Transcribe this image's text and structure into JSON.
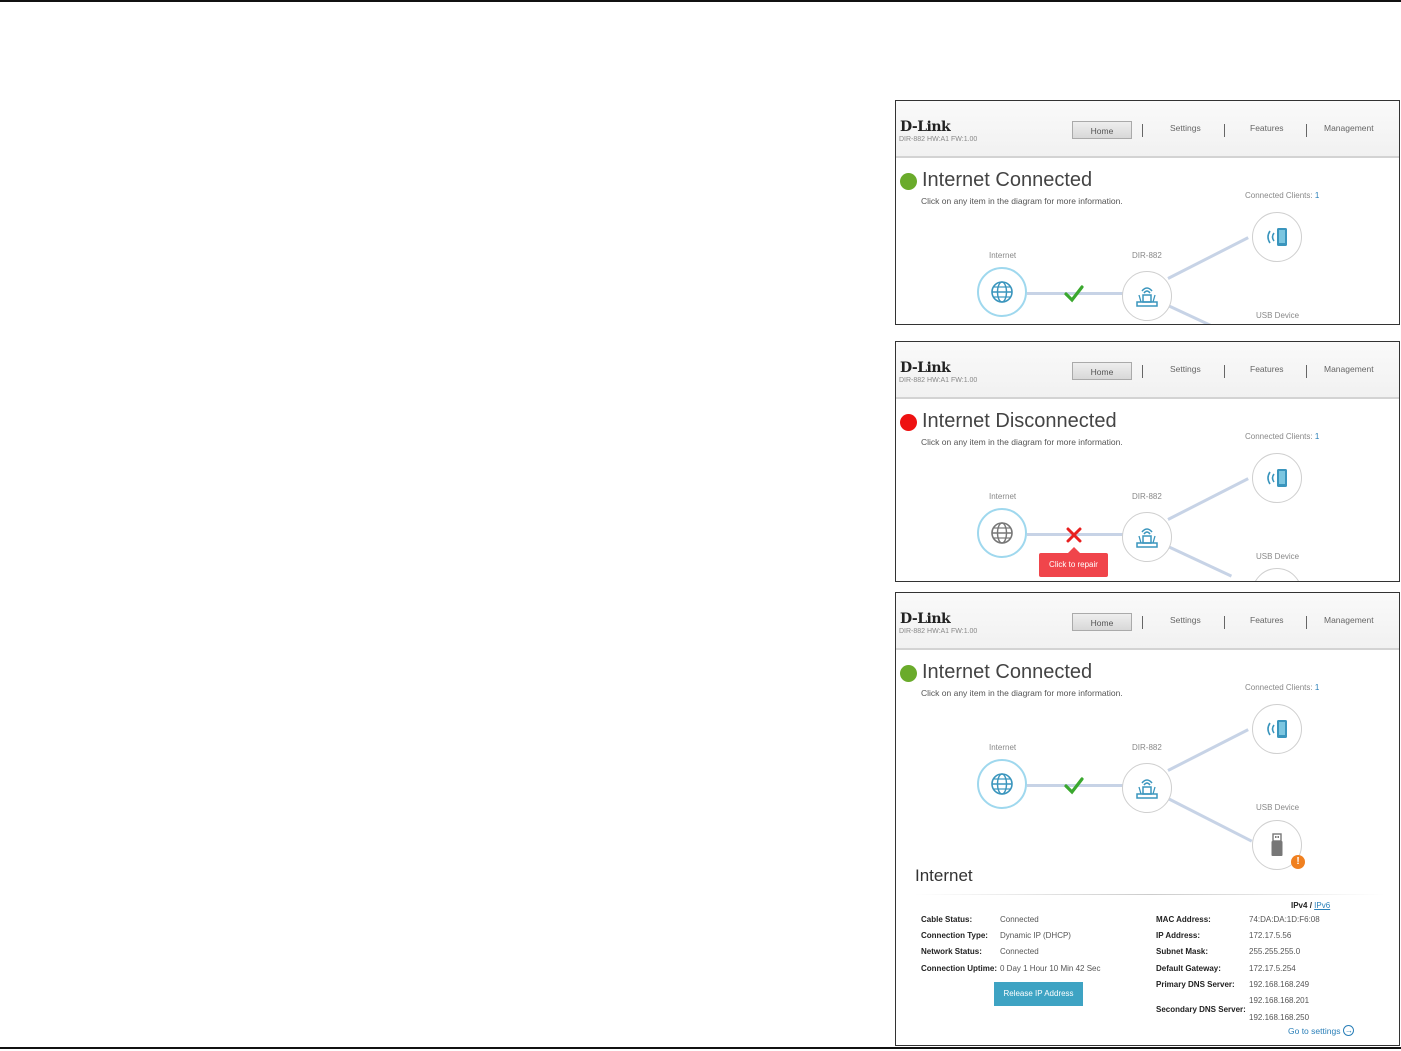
{
  "brand": {
    "logo": "D-Link",
    "version": "DIR-882 HW:A1 FW:1.00"
  },
  "nav": {
    "home": "Home",
    "settings": "Settings",
    "features": "Features",
    "management": "Management"
  },
  "diagram": {
    "internet": "Internet",
    "router": "DIR-882",
    "usb": "USB Device",
    "clients_label": "Connected Clients:",
    "clients_count": "1"
  },
  "subtitle": "Click on any item in the diagram for more information.",
  "panels": [
    {
      "status": "Internet Connected",
      "status_color": "#6aab2b"
    },
    {
      "status": "Internet Disconnected",
      "status_color": "#ee1111",
      "repair": "Click to repair"
    },
    {
      "status": "Internet Connected",
      "status_color": "#6aab2b"
    }
  ],
  "details": {
    "title": "Internet",
    "ipv4": "IPv4",
    "slash": "/",
    "ipv6": "IPv6",
    "left": [
      {
        "k": "Cable Status:",
        "v": "Connected"
      },
      {
        "k": "Connection Type:",
        "v": "Dynamic IP (DHCP)"
      },
      {
        "k": "Network Status:",
        "v": "Connected"
      },
      {
        "k": "Connection Uptime:",
        "v": "0 Day 1 Hour 10 Min 42 Sec"
      }
    ],
    "right": [
      {
        "k": "MAC Address:",
        "v": "74:DA:DA:1D:F6:08"
      },
      {
        "k": "IP Address:",
        "v": "172.17.5.56"
      },
      {
        "k": "Subnet Mask:",
        "v": "255.255.255.0"
      },
      {
        "k": "Default Gateway:",
        "v": "172.17.5.254"
      },
      {
        "k": "Primary DNS Server:",
        "v": "192.168.168.249"
      },
      {
        "k": "Secondary DNS Server:",
        "v": "192.168.168.201"
      }
    ],
    "extra_dns": "192.168.168.250",
    "release": "Release IP Address",
    "goto": "Go to settings"
  },
  "icons": [
    "globe-icon",
    "router-icon",
    "phone-wireless-icon",
    "usb-drive-icon",
    "checkmark-icon",
    "cross-icon",
    "warning-icon",
    "arrow-right-icon"
  ]
}
